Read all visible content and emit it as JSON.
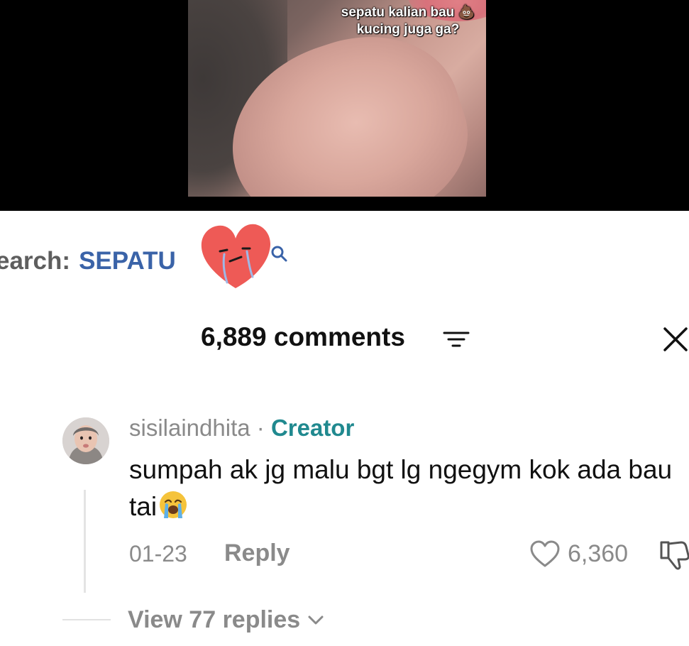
{
  "video": {
    "caption_line1": "sepatu kalian bau 💩",
    "caption_line2": "kucing juga ga?"
  },
  "search": {
    "prefix": "earch:",
    "term": "SEPATU",
    "term_color": "#3a63a8",
    "icon": "search-icon"
  },
  "comments_panel": {
    "title": "6,889 comments",
    "sort_icon": "sort-icon",
    "close_icon": "close-icon"
  },
  "comment": {
    "username": "sisilaindhita",
    "separator": "·",
    "badge": "Creator",
    "badge_color": "#20898f",
    "text": "sumpah ak jg malu bgt lg ngegym kok ada bau tai",
    "emoji": "loudly-crying-face-icon",
    "date": "01-23",
    "reply_label": "Reply",
    "likes": "6,360",
    "view_replies": "View 77 replies"
  },
  "colors": {
    "text_primary": "#111111",
    "text_secondary": "#8a8a8a",
    "background": "#ffffff",
    "video_background": "#000000"
  }
}
